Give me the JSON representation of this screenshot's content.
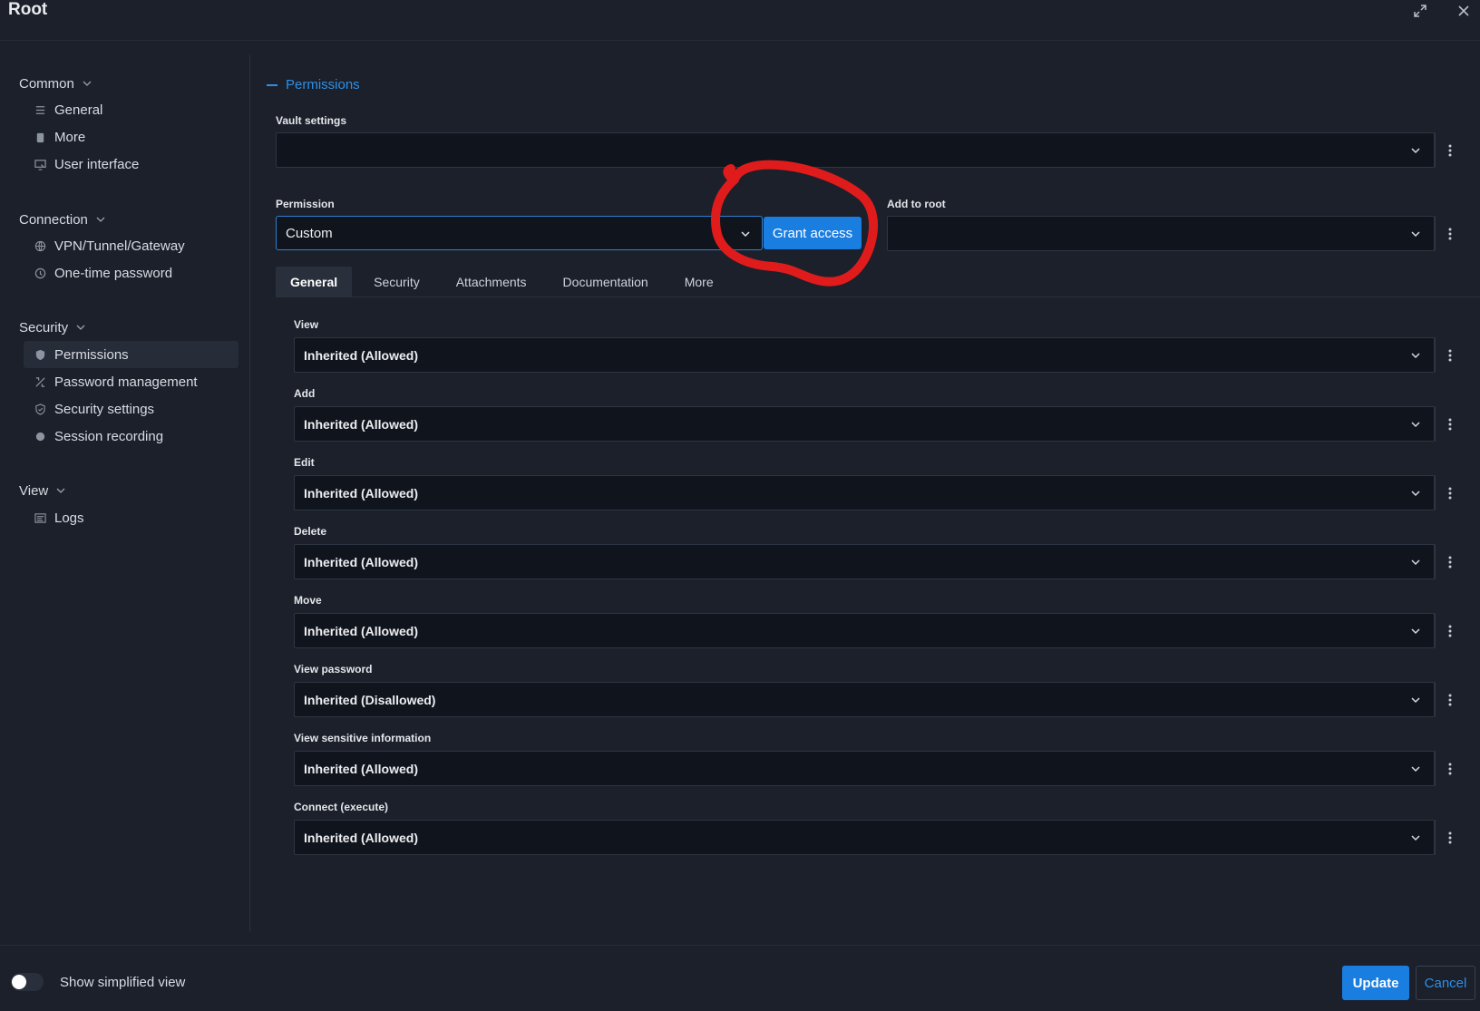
{
  "window": {
    "title": "Root"
  },
  "sidebar": {
    "sections": [
      {
        "label": "Common",
        "items": [
          {
            "label": "General",
            "icon": "list-icon"
          },
          {
            "label": "More",
            "icon": "clipboard-icon"
          },
          {
            "label": "User interface",
            "icon": "monitor-icon"
          }
        ]
      },
      {
        "label": "Connection",
        "items": [
          {
            "label": "VPN/Tunnel/Gateway",
            "icon": "globe-icon"
          },
          {
            "label": "One-time password",
            "icon": "clock-icon"
          }
        ]
      },
      {
        "label": "Security",
        "items": [
          {
            "label": "Permissions",
            "icon": "shield-icon",
            "active": true
          },
          {
            "label": "Password management",
            "icon": "key-icon"
          },
          {
            "label": "Security settings",
            "icon": "shield-check-icon"
          },
          {
            "label": "Session recording",
            "icon": "record-icon"
          }
        ]
      },
      {
        "label": "View",
        "items": [
          {
            "label": "Logs",
            "icon": "log-icon"
          }
        ]
      }
    ]
  },
  "main": {
    "section_title": "Permissions",
    "vault_settings": {
      "label": "Vault settings",
      "value": ""
    },
    "permission": {
      "label": "Permission",
      "value": "Custom"
    },
    "grant_access_label": "Grant access",
    "add_to_root": {
      "label": "Add to root",
      "value": ""
    },
    "tabs": [
      "General",
      "Security",
      "Attachments",
      "Documentation",
      "More"
    ],
    "active_tab": "General",
    "fields": [
      {
        "label": "View",
        "value": "Inherited (Allowed)"
      },
      {
        "label": "Add",
        "value": "Inherited (Allowed)"
      },
      {
        "label": "Edit",
        "value": "Inherited (Allowed)"
      },
      {
        "label": "Delete",
        "value": "Inherited (Allowed)"
      },
      {
        "label": "Move",
        "value": "Inherited (Allowed)"
      },
      {
        "label": "View password",
        "value": "Inherited (Disallowed)"
      },
      {
        "label": "View sensitive information",
        "value": "Inherited (Allowed)"
      },
      {
        "label": "Connect (execute)",
        "value": "Inherited (Allowed)"
      }
    ]
  },
  "footer": {
    "simplified_view_label": "Show simplified view",
    "simplified_view_on": false,
    "update_label": "Update",
    "cancel_label": "Cancel"
  },
  "colors": {
    "accent": "#1a7de0",
    "annotation": "#e01b1b",
    "background": "#1b202b",
    "field_bg": "#10141c"
  }
}
